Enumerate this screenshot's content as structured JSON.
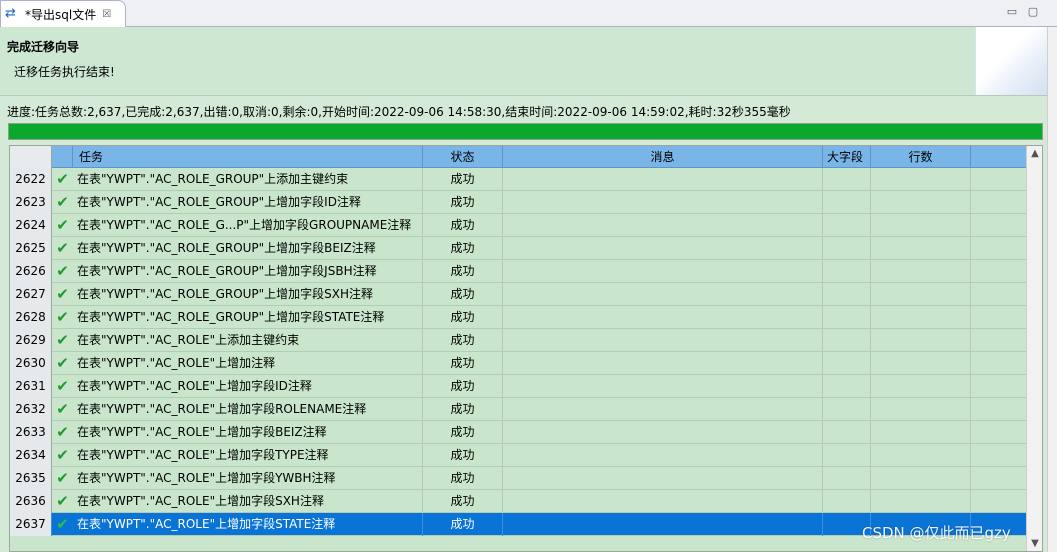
{
  "tab": {
    "title": "*导出sql文件",
    "close_glyph": "☒",
    "icon": "transfer-arrows-icon"
  },
  "window": {
    "minimize_glyph": "▭",
    "maximize_glyph": "▢"
  },
  "header": {
    "title": "完成迁移向导",
    "subtitle": "迁移任务执行结束!"
  },
  "progress": {
    "text": "进度:任务总数:2,637,已完成:2,637,出错:0,取消:0,剩余:0,开始时间:2022-09-06 14:58:30,结束时间:2022-09-06 14:59:02,耗时:32秒355毫秒",
    "fraction": 1.0,
    "color": "#0aa92e"
  },
  "table": {
    "columns": {
      "task": "任务",
      "status": "状态",
      "message": "消息",
      "bigfield": "大字段",
      "rows": "行数"
    },
    "rows": [
      {
        "num": "2622",
        "task": "在表\"YWPT\".\"AC_ROLE_GROUP\"上添加主键约束",
        "status": "成功"
      },
      {
        "num": "2623",
        "task": "在表\"YWPT\".\"AC_ROLE_GROUP\"上增加字段ID注释",
        "status": "成功"
      },
      {
        "num": "2624",
        "task": "在表\"YWPT\".\"AC_ROLE_G...P\"上增加字段GROUPNAME注释",
        "status": "成功"
      },
      {
        "num": "2625",
        "task": "在表\"YWPT\".\"AC_ROLE_GROUP\"上增加字段BEIZ注释",
        "status": "成功"
      },
      {
        "num": "2626",
        "task": "在表\"YWPT\".\"AC_ROLE_GROUP\"上增加字段JSBH注释",
        "status": "成功"
      },
      {
        "num": "2627",
        "task": "在表\"YWPT\".\"AC_ROLE_GROUP\"上增加字段SXH注释",
        "status": "成功"
      },
      {
        "num": "2628",
        "task": "在表\"YWPT\".\"AC_ROLE_GROUP\"上增加字段STATE注释",
        "status": "成功"
      },
      {
        "num": "2629",
        "task": "在表\"YWPT\".\"AC_ROLE\"上添加主键约束",
        "status": "成功"
      },
      {
        "num": "2630",
        "task": "在表\"YWPT\".\"AC_ROLE\"上增加注释",
        "status": "成功"
      },
      {
        "num": "2631",
        "task": "在表\"YWPT\".\"AC_ROLE\"上增加字段ID注释",
        "status": "成功"
      },
      {
        "num": "2632",
        "task": "在表\"YWPT\".\"AC_ROLE\"上增加字段ROLENAME注释",
        "status": "成功"
      },
      {
        "num": "2633",
        "task": "在表\"YWPT\".\"AC_ROLE\"上增加字段BEIZ注释",
        "status": "成功"
      },
      {
        "num": "2634",
        "task": "在表\"YWPT\".\"AC_ROLE\"上增加字段TYPE注释",
        "status": "成功"
      },
      {
        "num": "2635",
        "task": "在表\"YWPT\".\"AC_ROLE\"上增加字段YWBH注释",
        "status": "成功"
      },
      {
        "num": "2636",
        "task": "在表\"YWPT\".\"AC_ROLE\"上增加字段SXH注释",
        "status": "成功"
      },
      {
        "num": "2637",
        "task": "在表\"YWPT\".\"AC_ROLE\"上增加字段STATE注释",
        "status": "成功",
        "selected": true
      }
    ],
    "success_icon": "check-icon",
    "selected_color": "#0a74d6"
  },
  "watermark": "CSDN @仅此而已gzy"
}
